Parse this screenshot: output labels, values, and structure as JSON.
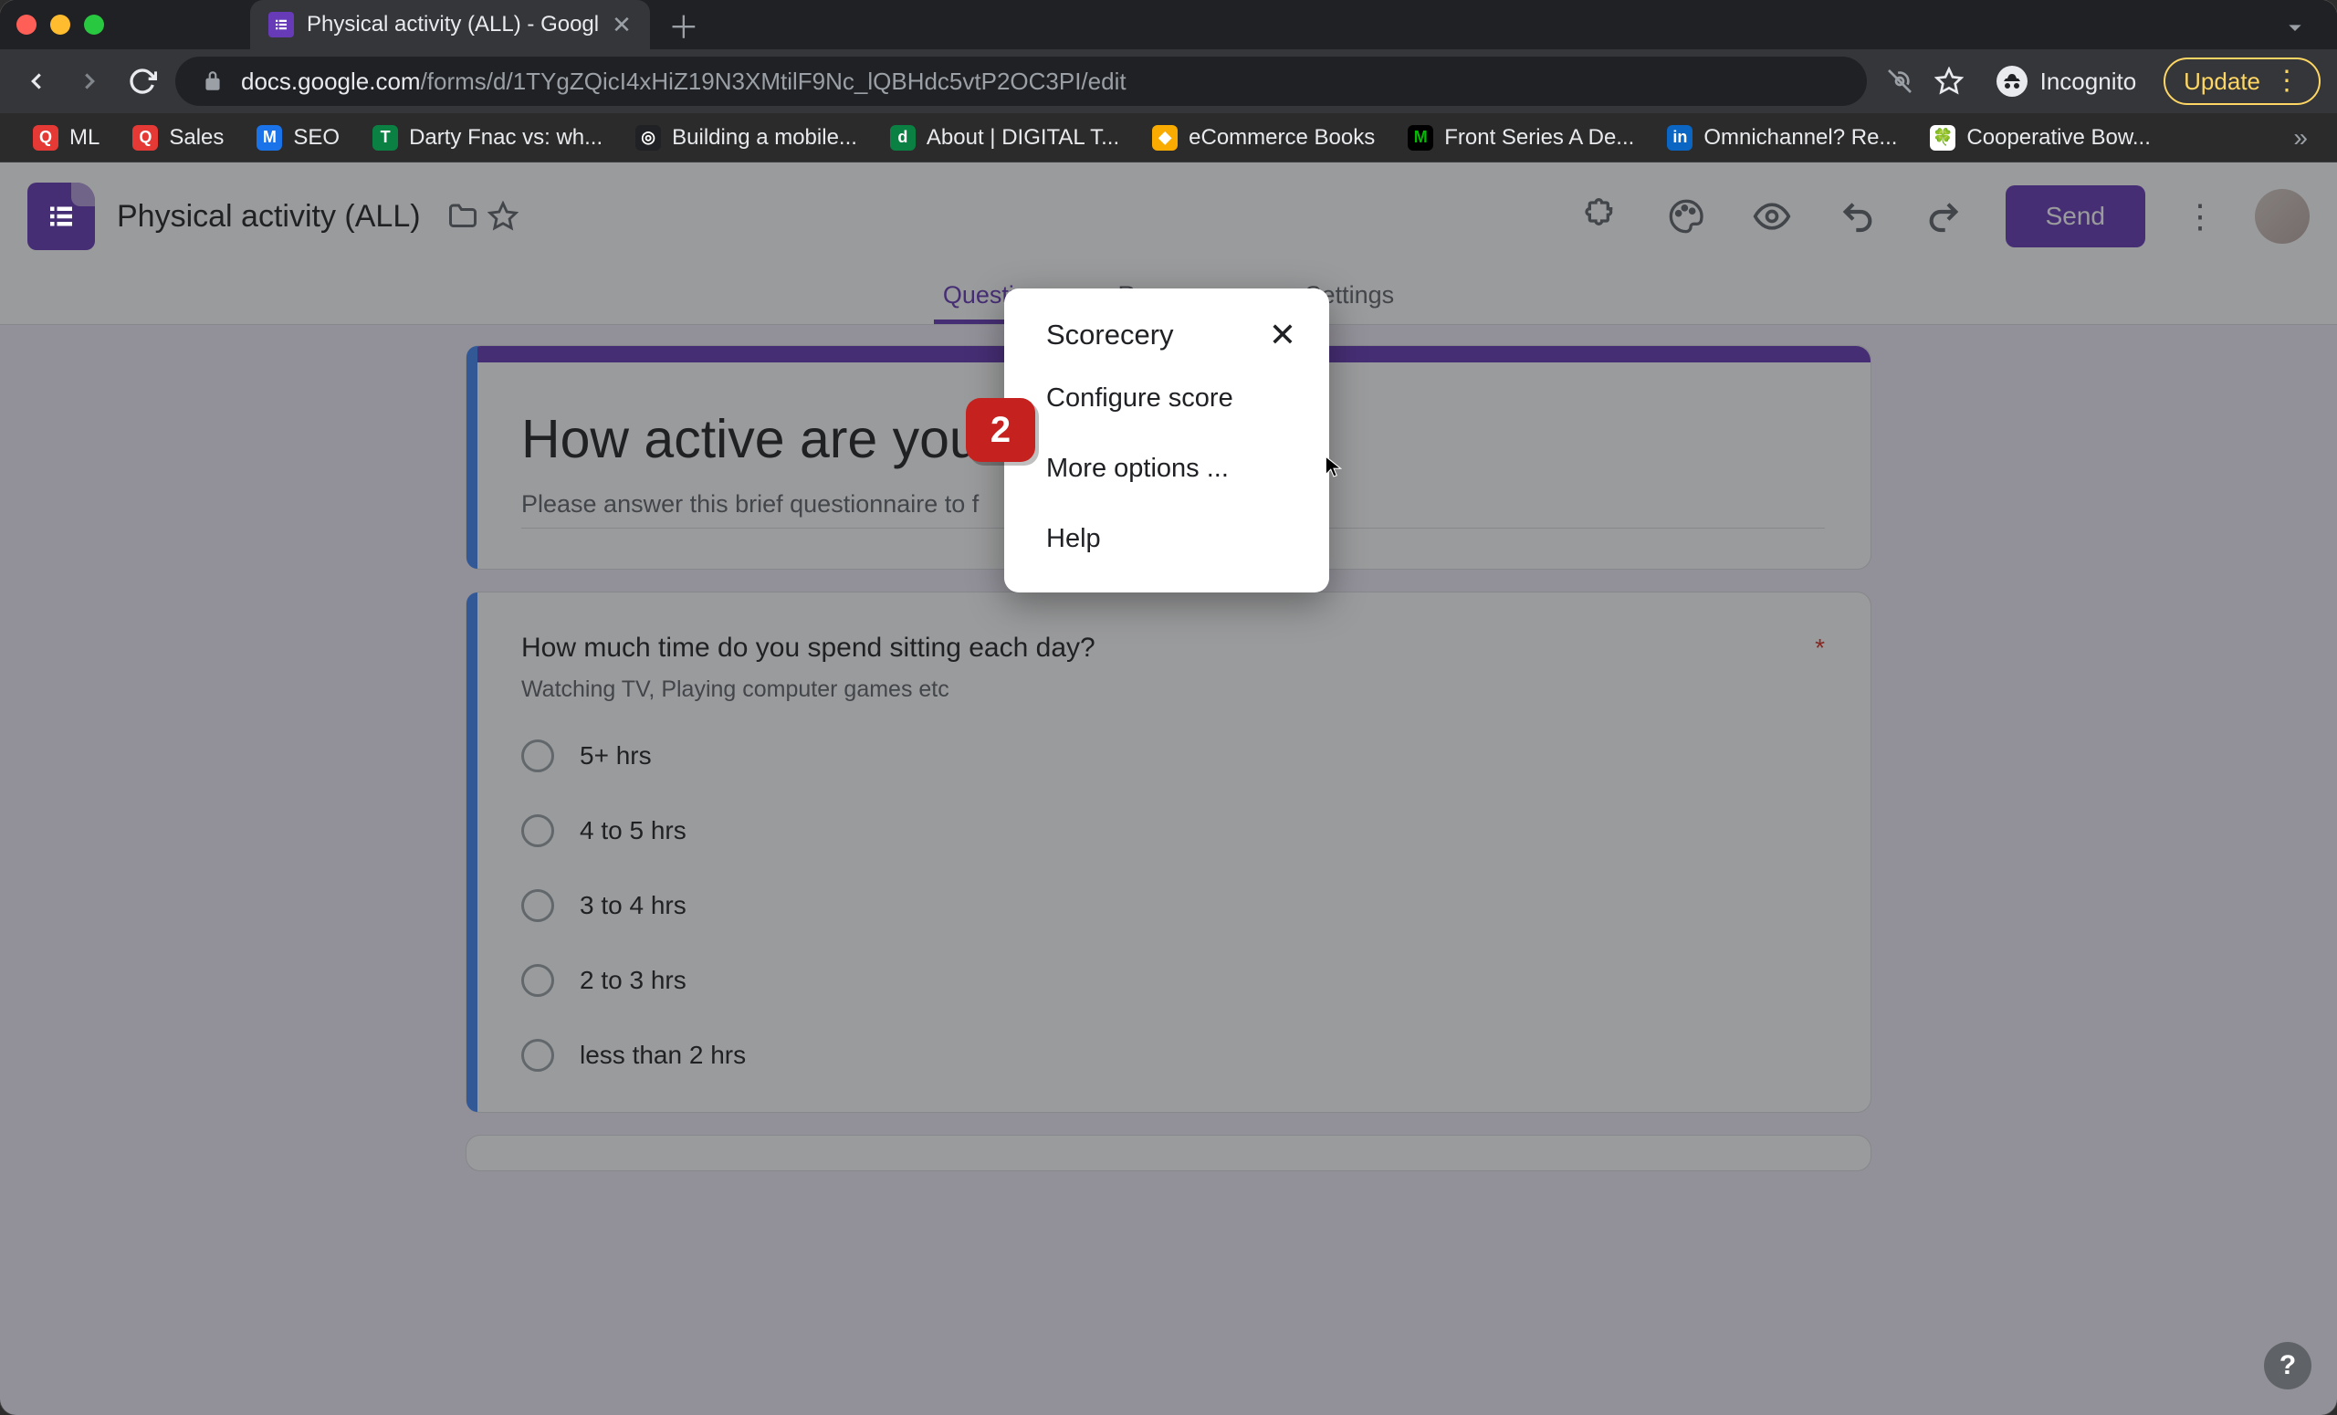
{
  "browser": {
    "tab_title": "Physical activity (ALL) - Googl",
    "url_host": "docs.google.com",
    "url_path": "/forms/d/1TYgZQicI4xHiZ19N3XMtilF9Nc_lQBHdc5vtP2OC3PI/edit",
    "incognito_label": "Incognito",
    "update_label": "Update"
  },
  "bookmarks": [
    {
      "label": "ML",
      "icon_bg": "#e53935",
      "icon_txt": "Q"
    },
    {
      "label": "Sales",
      "icon_bg": "#e53935",
      "icon_txt": "Q"
    },
    {
      "label": "SEO",
      "icon_bg": "#1a73e8",
      "icon_txt": "M"
    },
    {
      "label": "Darty Fnac vs: wh...",
      "icon_bg": "#0b8043",
      "icon_txt": "T"
    },
    {
      "label": "Building a mobile...",
      "icon_bg": "#202124",
      "icon_txt": "◎"
    },
    {
      "label": "About | DIGITAL T...",
      "icon_bg": "#0b8043",
      "icon_txt": "d"
    },
    {
      "label": "eCommerce Books",
      "icon_bg": "#f9ab00",
      "icon_txt": "◆"
    },
    {
      "label": "Front Series A De...",
      "icon_bg": "#000",
      "icon_txt": "M"
    },
    {
      "label": "Omnichannel? Re...",
      "icon_bg": "#0a66c2",
      "icon_txt": "in"
    },
    {
      "label": "Cooperative Bow...",
      "icon_bg": "#0b8043",
      "icon_txt": "🍀"
    }
  ],
  "header": {
    "doc_title": "Physical activity (ALL)",
    "send_label": "Send"
  },
  "tabs": {
    "questions": "Questions",
    "responses": "Responses",
    "settings": "Settings"
  },
  "form": {
    "title": "How active are you?",
    "description": "Please answer this brief questionnaire to f",
    "q1": {
      "title": "How much time do you spend sitting each day?",
      "desc": "Watching TV, Playing computer games etc",
      "options": [
        "5+ hrs",
        "4 to 5 hrs",
        "3 to 4 hrs",
        "2 to 3 hrs",
        "less than 2 hrs"
      ]
    },
    "required_star": "*"
  },
  "popup": {
    "title": "Scorecery",
    "item_configure": "Configure score",
    "item_more": "More options ...",
    "item_help": "Help"
  },
  "annotation": {
    "badge": "2"
  },
  "help_fab": "?"
}
